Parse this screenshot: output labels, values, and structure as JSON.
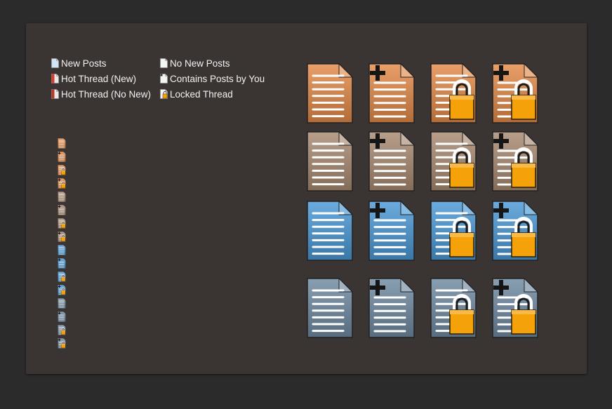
{
  "colors": {
    "background": "#2c2b2b",
    "orange": "#e48a48",
    "tan": "#a98a72",
    "blue": "#4a98d6",
    "slate": "#6f8aa1",
    "lock": "#f5a20a"
  },
  "legend": [
    {
      "label": "New Posts",
      "icon": "new-posts-icon"
    },
    {
      "label": "Hot Thread (New)",
      "icon": "hot-thread-new-icon"
    },
    {
      "label": "Hot Thread (No New)",
      "icon": "hot-thread-no-new-icon"
    },
    {
      "label": "No New Posts",
      "icon": "no-new-posts-icon"
    },
    {
      "label": "Contains Posts by You",
      "icon": "contains-posts-by-you-icon"
    },
    {
      "label": "Locked Thread",
      "icon": "locked-thread-icon"
    }
  ],
  "small_icons": [
    {
      "color": "orange",
      "variant": "plain"
    },
    {
      "color": "orange",
      "variant": "plus"
    },
    {
      "color": "orange",
      "variant": "lock"
    },
    {
      "color": "orange",
      "variant": "plus-lock"
    },
    {
      "color": "tan",
      "variant": "plain"
    },
    {
      "color": "tan",
      "variant": "plus"
    },
    {
      "color": "tan",
      "variant": "lock"
    },
    {
      "color": "tan",
      "variant": "plus-lock"
    },
    {
      "color": "blue",
      "variant": "plain"
    },
    {
      "color": "blue",
      "variant": "plus"
    },
    {
      "color": "blue",
      "variant": "lock"
    },
    {
      "color": "blue",
      "variant": "plus-lock"
    },
    {
      "color": "slate",
      "variant": "plain"
    },
    {
      "color": "slate",
      "variant": "plus"
    },
    {
      "color": "slate",
      "variant": "lock"
    },
    {
      "color": "slate",
      "variant": "plus-lock"
    }
  ],
  "big_icons": {
    "rows": [
      "orange",
      "tan",
      "blue",
      "slate"
    ],
    "variants": [
      "plain",
      "plus",
      "lock",
      "plus-lock"
    ]
  }
}
